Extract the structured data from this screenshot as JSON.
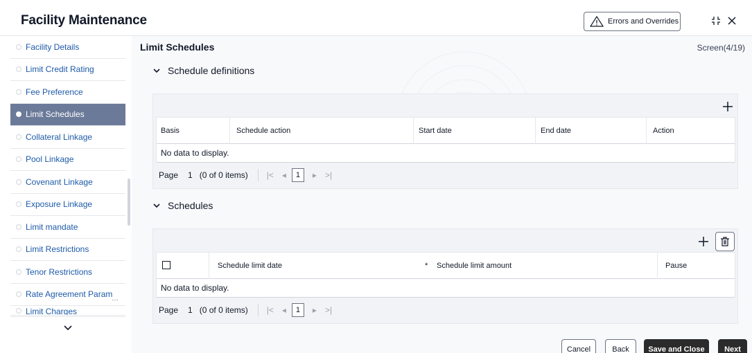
{
  "header": {
    "title": "Facility Maintenance",
    "errors_button": "Errors and Overrides"
  },
  "sidebar": {
    "items": [
      {
        "label": "Facility Details"
      },
      {
        "label": "Limit Credit Rating"
      },
      {
        "label": "Fee Preference"
      },
      {
        "label": "Limit Schedules"
      },
      {
        "label": "Collateral Linkage"
      },
      {
        "label": "Pool Linkage"
      },
      {
        "label": "Covenant Linkage"
      },
      {
        "label": "Exposure Linkage"
      },
      {
        "label": "Limit mandate"
      },
      {
        "label": "Limit Restrictions"
      },
      {
        "label": "Tenor Restrictions"
      },
      {
        "label": "Rate Agreement Param"
      },
      {
        "label": "Limit Charges"
      }
    ],
    "active_index": 3
  },
  "main": {
    "section_title": "Limit Schedules",
    "screen_count": "Screen(4/19)",
    "schedule_definitions": {
      "heading": "Schedule definitions",
      "columns": [
        "Basis",
        "Schedule action",
        "Start date",
        "End date",
        "Action"
      ],
      "empty_text": "No data to display.",
      "pager": {
        "label": "Page",
        "page": "1",
        "items": "(0 of 0 items)",
        "current": "1"
      }
    },
    "schedules": {
      "heading": "Schedules",
      "columns": [
        "Schedule limit date",
        "*",
        "Schedule limit amount",
        "Pause"
      ],
      "empty_text": "No data to display.",
      "pager": {
        "label": "Page",
        "page": "1",
        "items": "(0 of 0 items)",
        "current": "1"
      }
    }
  },
  "footer": {
    "cancel": "Cancel",
    "back": "Back",
    "save_close": "Save and Close",
    "next": "Next"
  }
}
